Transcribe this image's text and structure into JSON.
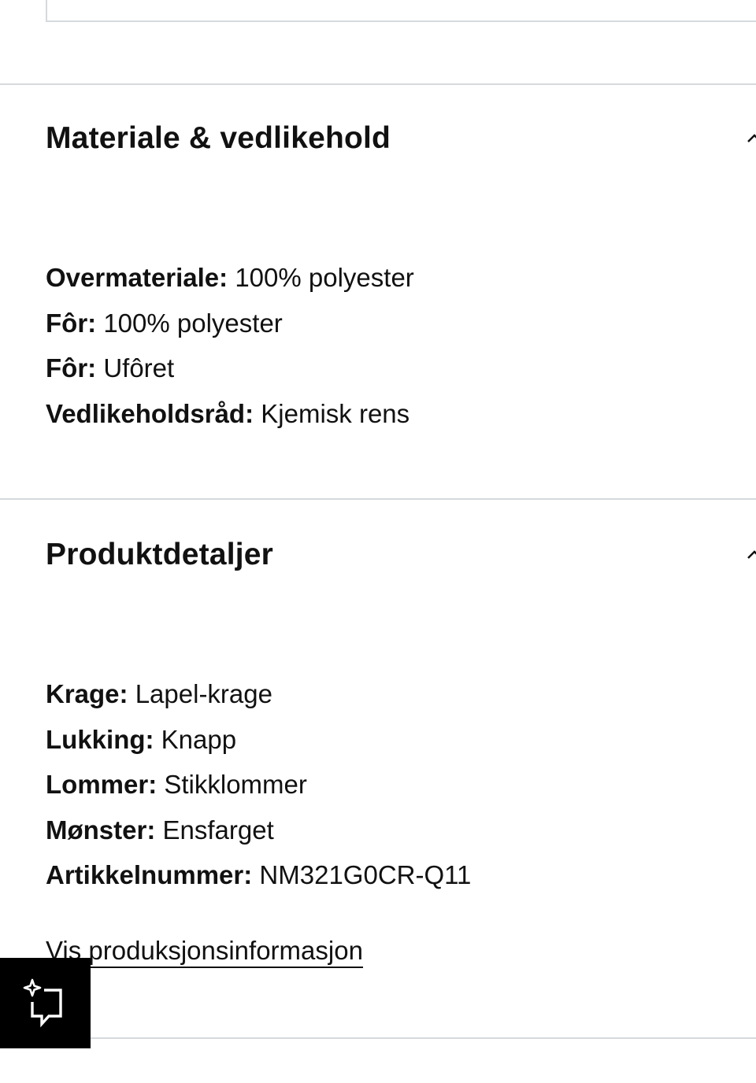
{
  "material_section": {
    "title": "Materiale & vedlikehold",
    "items": [
      {
        "key": "Overmateriale:",
        "value": "100% polyester"
      },
      {
        "key": "Fôr:",
        "value": "100% polyester"
      },
      {
        "key": "Fôr:",
        "value": "Ufôret"
      },
      {
        "key": "Vedlikeholdsråd:",
        "value": "Kjemisk rens"
      }
    ]
  },
  "details_section": {
    "title": "Produktdetaljer",
    "items": [
      {
        "key": "Krage:",
        "value": "Lapel-krage"
      },
      {
        "key": "Lukking:",
        "value": "Knapp"
      },
      {
        "key": "Lommer:",
        "value": "Stikklommer"
      },
      {
        "key": "Mønster:",
        "value": "Ensfarget"
      },
      {
        "key": "Artikkelnummer:",
        "value": "NM321G0CR-Q11"
      }
    ],
    "link_label": "Vis produksjonsinformasjon"
  },
  "icons": {
    "section_toggle": "chevron-up-icon",
    "fab": "sparkle-feedback-icon"
  },
  "colors": {
    "text": "#111111",
    "divider": "#d6dadd",
    "fab_background": "#000000",
    "fab_icon": "#ffffff"
  }
}
